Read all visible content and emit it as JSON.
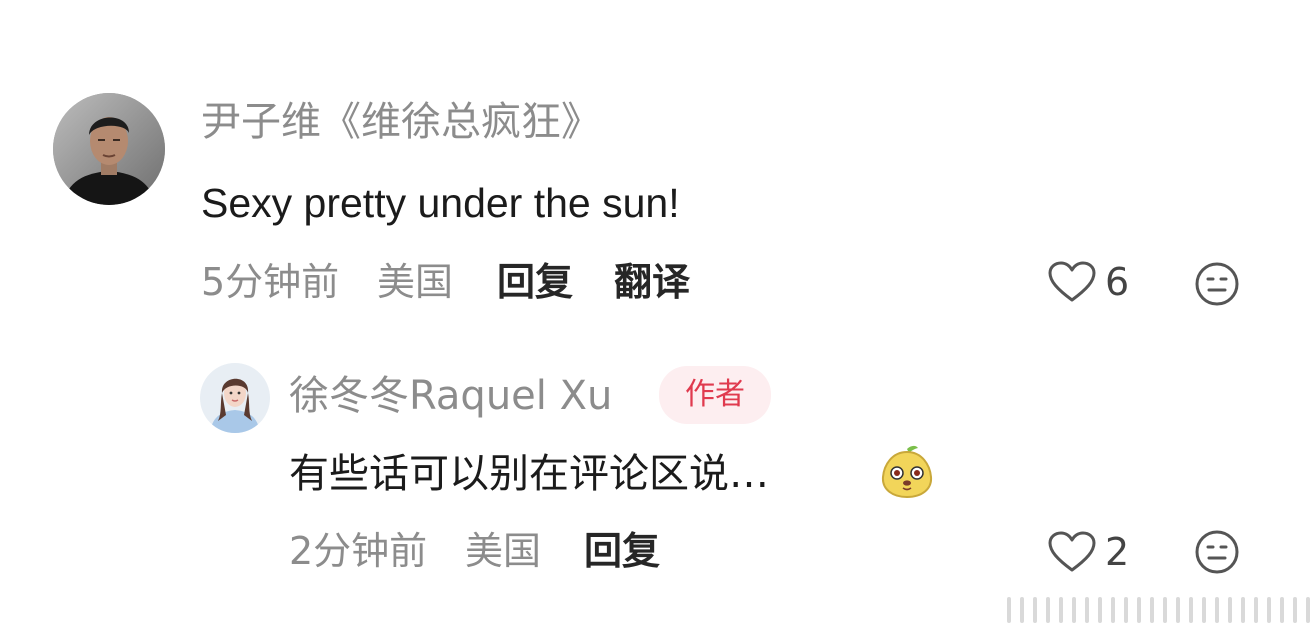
{
  "comments": [
    {
      "username": "尹子维《维徐总疯狂》",
      "text": "Sexy pretty under the sun!",
      "time": "5分钟前",
      "location": "美国",
      "reply_label": "回复",
      "translate_label": "翻译",
      "likes": "6",
      "avatar_icon": "person-avatar-dark"
    },
    {
      "username": "徐冬冬Raquel Xu",
      "badge": "作者",
      "text": "有些话可以别在评论区说…",
      "sticker_icon": "pear-face-sticker",
      "time": "2分钟前",
      "location": "美国",
      "reply_label": "回复",
      "likes": "2",
      "avatar_icon": "person-avatar-light"
    }
  ],
  "colors": {
    "username": "#8c8c8c",
    "text": "#1b1b1b",
    "action": "#262626",
    "badge_bg": "#fdeef0",
    "badge_text": "#e03a4e"
  }
}
